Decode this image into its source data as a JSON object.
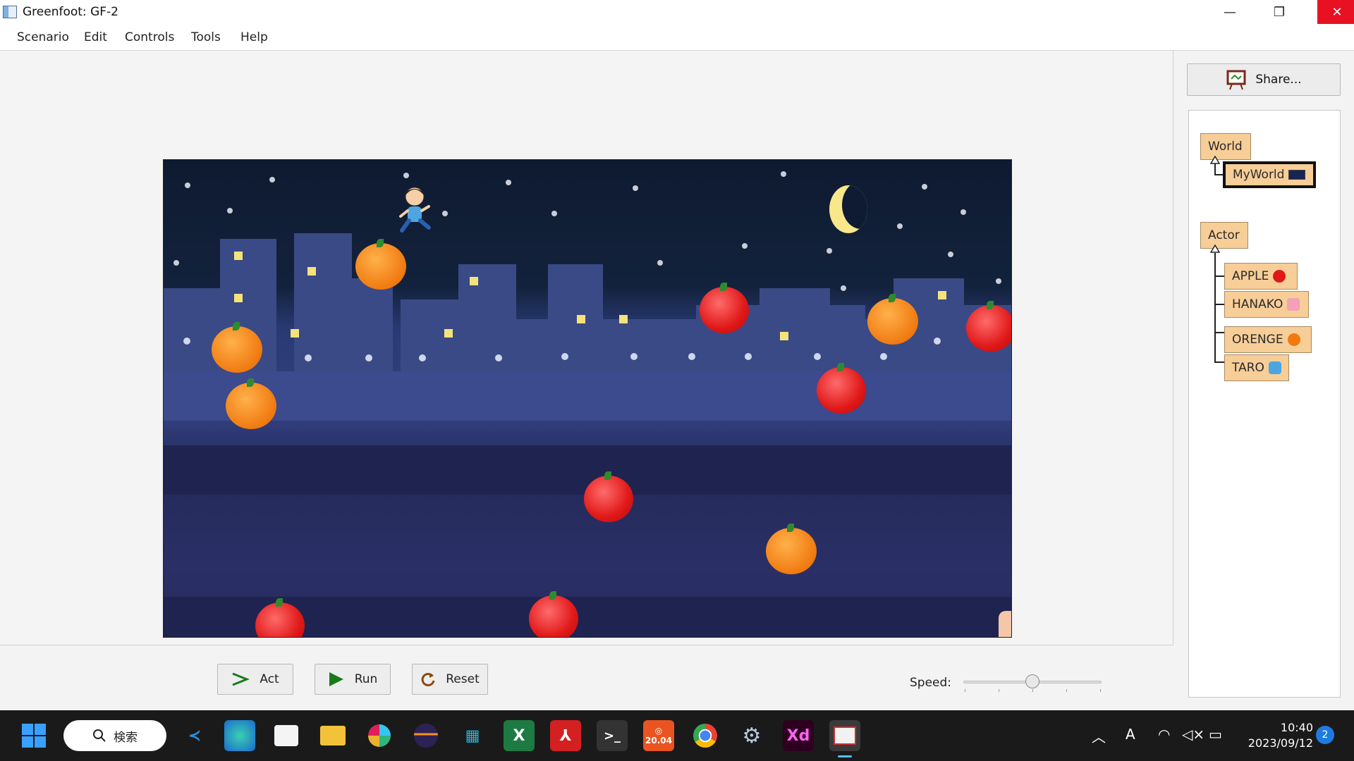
{
  "window": {
    "title": "Greenfoot: GF-2",
    "min": "—",
    "max": "❐",
    "close": "✕"
  },
  "menu": [
    "Scenario",
    "Edit",
    "Controls",
    "Tools",
    "Help"
  ],
  "controls": {
    "act": "Act",
    "run": "Run",
    "reset": "Reset",
    "speed_label": "Speed:",
    "speed_value": 0.55
  },
  "sidebar": {
    "share": "Share...",
    "world_root": "World",
    "world_sub": "MyWorld",
    "actor_root": "Actor",
    "actors": [
      "APPLE",
      "HANAKO",
      "ORENGE",
      "TARO"
    ]
  },
  "taskbar": {
    "search": "検索",
    "time": "10:40",
    "date": "2023/09/12",
    "notifications": "2",
    "ubuntu_badge": "20.04",
    "xd": "Xd"
  },
  "icons": {
    "act": "arrow-right-icon",
    "run": "play-icon",
    "reset": "refresh-icon",
    "share": "easel-icon"
  },
  "colors": {
    "class_box": "#f7cd98",
    "sky": "#0e1a30",
    "close": "#e81123",
    "accent": "#1f7be0"
  }
}
